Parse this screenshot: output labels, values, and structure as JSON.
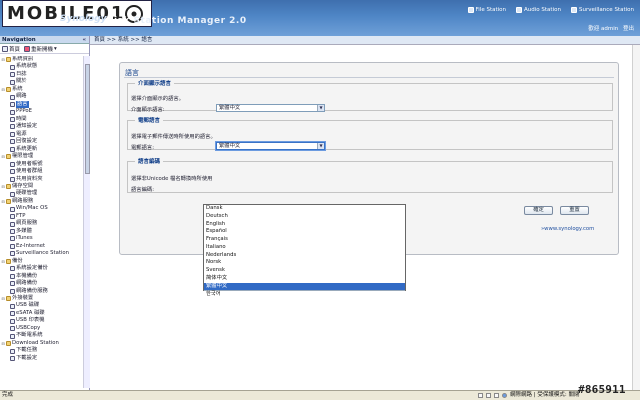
{
  "header": {
    "watermark_logo": "MOBILE01",
    "brand": "Synology",
    "title_part1": "Disk",
    "title_part2": "Station Manager 2.0",
    "links": [
      {
        "label": "File Station",
        "icon": "file-station-icon"
      },
      {
        "label": "Audio Station",
        "icon": "audio-station-icon"
      },
      {
        "label": "Surveillance Station",
        "icon": "surveillance-station-icon"
      }
    ],
    "welcome": "歡迎 admin",
    "logout": "登出"
  },
  "sidebar": {
    "title": "Navigation",
    "collapse": "«",
    "home_label": "首頁",
    "reload_label": "重新開機",
    "items": [
      {
        "label": "系統資訊",
        "level": 0,
        "expanded": true
      },
      {
        "label": "系統狀態",
        "level": 1
      },
      {
        "label": "日誌",
        "level": 1
      },
      {
        "label": "關於",
        "level": 1
      },
      {
        "label": "系統",
        "level": 0,
        "expanded": true
      },
      {
        "label": "網路",
        "level": 1
      },
      {
        "label": "語言",
        "level": 1,
        "selected": true
      },
      {
        "label": "PPPoE",
        "level": 1
      },
      {
        "label": "時間",
        "level": 1
      },
      {
        "label": "通知設定",
        "level": 1
      },
      {
        "label": "電源",
        "level": 1
      },
      {
        "label": "回復設定",
        "level": 1
      },
      {
        "label": "系統更新",
        "level": 1
      },
      {
        "label": "權限管理",
        "level": 0,
        "expanded": true
      },
      {
        "label": "使用者帳號",
        "level": 1
      },
      {
        "label": "使用者群組",
        "level": 1
      },
      {
        "label": "共用資料夾",
        "level": 1
      },
      {
        "label": "儲存空間",
        "level": 0,
        "expanded": true
      },
      {
        "label": "硬碟管理",
        "level": 1
      },
      {
        "label": "網路服務",
        "level": 0,
        "expanded": true
      },
      {
        "label": "Win/Mac OS",
        "level": 1
      },
      {
        "label": "FTP",
        "level": 1
      },
      {
        "label": "網頁服務",
        "level": 1
      },
      {
        "label": "多媒體",
        "level": 1
      },
      {
        "label": "iTunes",
        "level": 1
      },
      {
        "label": "Ez-Internet",
        "level": 1
      },
      {
        "label": "Surveillance Station",
        "level": 1
      },
      {
        "label": "備份",
        "level": 0,
        "expanded": true
      },
      {
        "label": "系統設定備份",
        "level": 1
      },
      {
        "label": "本機備份",
        "level": 1
      },
      {
        "label": "網路備份",
        "level": 1
      },
      {
        "label": "網路備份服務",
        "level": 1
      },
      {
        "label": "外接裝置",
        "level": 0,
        "expanded": true
      },
      {
        "label": "USB 磁碟",
        "level": 1
      },
      {
        "label": "eSATA 磁碟",
        "level": 1
      },
      {
        "label": "USB 印表機",
        "level": 1
      },
      {
        "label": "USBCopy",
        "level": 1
      },
      {
        "label": "不斷電系統",
        "level": 1
      },
      {
        "label": "Download Station",
        "level": 0,
        "expanded": true
      },
      {
        "label": "下載任務",
        "level": 1
      },
      {
        "label": "下載設定",
        "level": 1
      }
    ]
  },
  "breadcrumb": "首頁 >> 系統 >> 語言",
  "panel": {
    "title": "語言",
    "display": {
      "legend": "介面顯示語言",
      "desc": "選擇介面顯示的語言。",
      "label": "介面顯示語言:",
      "value": "繁體中文"
    },
    "email": {
      "legend": "電郵語言",
      "desc": "選擇電子郵件傳送時所使用的語言。",
      "label": "電郵語言:",
      "value": "繁體中文"
    },
    "codepage": {
      "legend": "語言編碼",
      "desc": "選擇非Unicode 檔名轉換時所使用",
      "label": "語言編碼:"
    },
    "ok_label": "確定",
    "reset_label": "重置"
  },
  "dropdown": {
    "options": [
      "Dansk",
      "Deutsch",
      "English",
      "Español",
      "Français",
      "Italiano",
      "Nederlands",
      "Norsk",
      "Svensk",
      "简体中文",
      "繁體中文",
      "한국어"
    ],
    "selected_index": 10
  },
  "footer_link": "www.synology.com",
  "statusbar": {
    "left": "完成",
    "right": "網際網路 | 受保護模式: 關閉"
  },
  "watermark": "#865911",
  "colors": {
    "header": "#4f86c6",
    "selection": "#316ac5",
    "panel_title": "#15428b"
  }
}
